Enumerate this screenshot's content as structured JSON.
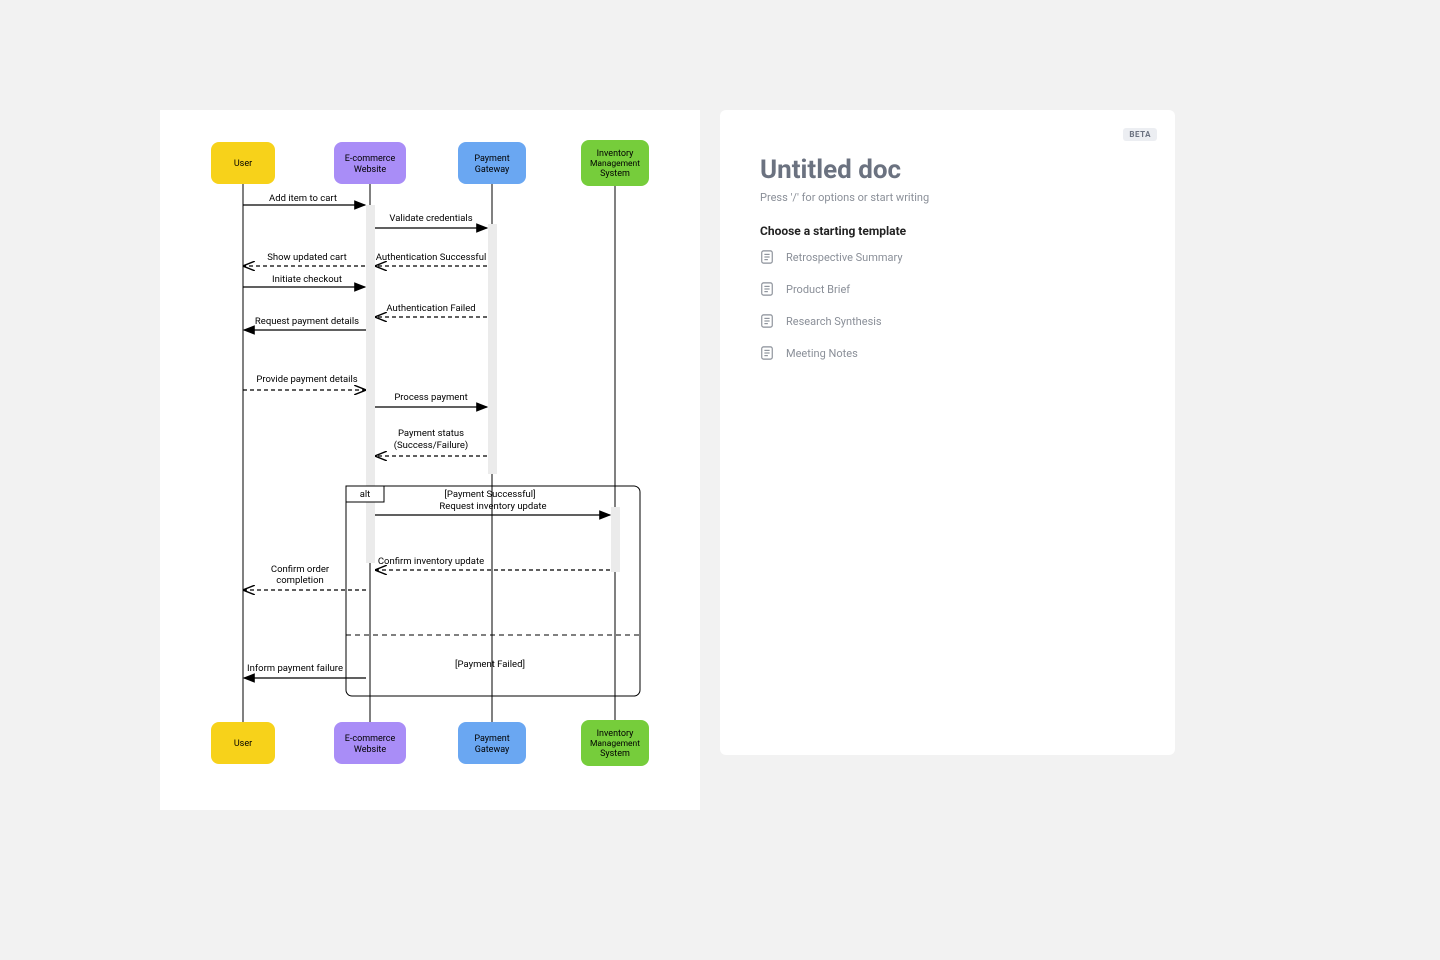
{
  "diagram": {
    "actors": [
      {
        "id": "user",
        "label": "User",
        "color": "#f7d21a"
      },
      {
        "id": "site",
        "label_line1": "E-commerce",
        "label_line2": "Website",
        "color": "#a98df7"
      },
      {
        "id": "pg",
        "label_line1": "Payment",
        "label_line2": "Gateway",
        "color": "#6aa7f2"
      },
      {
        "id": "inv",
        "label_line1": "Inventory",
        "label_line2": "Management",
        "label_line3": "System",
        "color": "#76cd3b"
      }
    ],
    "messages": {
      "m1": "Add item to cart",
      "m2": "Validate credentials",
      "m3": "Show updated cart",
      "m3b": "Authentication Successful",
      "m4": "Initiate checkout",
      "m5": "Authentication Failed",
      "m6": "Request payment details",
      "m7": "Provide payment details",
      "m8": "Process payment",
      "m9a": "Payment status",
      "m9b": "(Success/Failure)",
      "m10": "Request inventory update",
      "m11": "Confirm inventory update",
      "m12a": "Confirm order",
      "m12b": "completion",
      "m13": "Inform payment failure"
    },
    "frame": {
      "operator": "alt",
      "guard1": "[Payment Successful]",
      "guard2": "[Payment Failed]"
    }
  },
  "doc": {
    "title": "Untitled doc",
    "subtitle": "Press '/' for options or start writing",
    "template_header": "Choose a starting template",
    "beta": "BETA",
    "templates": [
      {
        "label": "Retrospective Summary"
      },
      {
        "label": "Product Brief"
      },
      {
        "label": "Research Synthesis"
      },
      {
        "label": "Meeting Notes"
      }
    ]
  }
}
